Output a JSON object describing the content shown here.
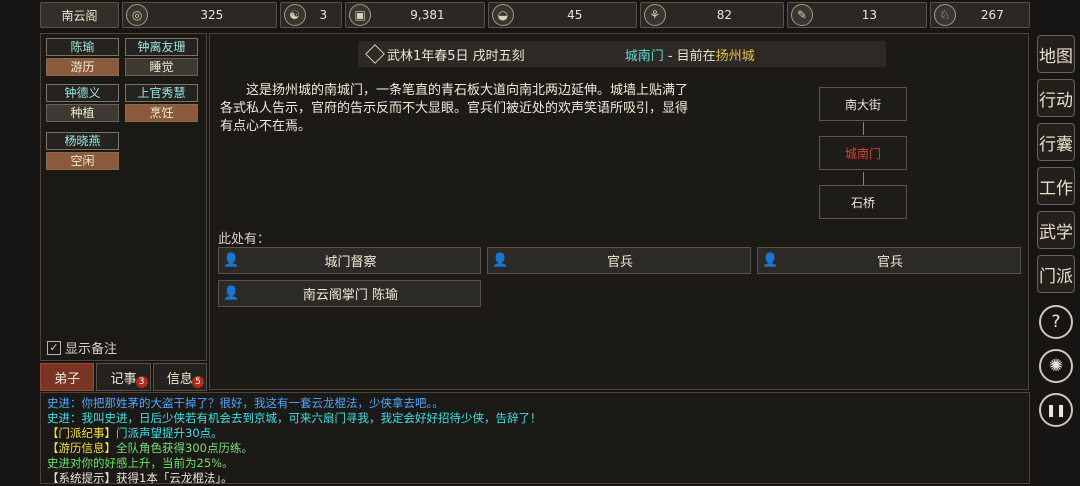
{
  "topbar": {
    "sect_name": "南云阁",
    "stats": [
      {
        "icon": "coin-icon",
        "glyph": "◎",
        "value": "325"
      },
      {
        "icon": "yinyang-icon",
        "glyph": "☯",
        "value": "3"
      },
      {
        "icon": "money-icon",
        "glyph": "▣",
        "value": "9,381"
      },
      {
        "icon": "food-bowl-icon",
        "glyph": "◒",
        "value": "45"
      },
      {
        "icon": "herb-icon",
        "glyph": "⚘",
        "value": "82"
      },
      {
        "icon": "scroll-icon",
        "glyph": "✎",
        "value": "13"
      },
      {
        "icon": "horse-icon",
        "glyph": "♘",
        "value": "267"
      }
    ]
  },
  "disciples": [
    {
      "name": "陈瑜",
      "status": "游历",
      "active": true
    },
    {
      "name": "钟离友珊",
      "status": "睡觉",
      "active": false
    },
    {
      "name": "钟德义",
      "status": "种植",
      "active": false
    },
    {
      "name": "上官秀慧",
      "status": "烹饪",
      "active": true
    },
    {
      "name": "杨晓燕",
      "status": "空闲",
      "active": true
    }
  ],
  "memo_label": "显示备注",
  "bottom_tabs": [
    {
      "label": "弟子",
      "badge": ""
    },
    {
      "label": "记事",
      "badge": "3"
    },
    {
      "label": "信息",
      "badge": "5"
    }
  ],
  "header": {
    "time": "武林1年春5日 戌时五刻",
    "location": "城南门",
    "separator": " - 目前在",
    "city": "扬州城"
  },
  "description": "这是扬州城的南城门，一条笔直的青石板大道向南北两边延伸。城墙上贴满了各式私人告示，官府的告示反而不大显眼。官兵们被近处的欢声笑语所吸引，显得有点心不在焉。",
  "map": {
    "north": "南大街",
    "current": "城南门",
    "south": "石桥"
  },
  "here_label": "此处有：",
  "npcs": [
    "城门督察",
    "官兵",
    "官兵",
    "南云阁掌门 陈瑜"
  ],
  "log": [
    {
      "color": "c-blue",
      "text": "史进：你把那姓茅的大盗干掉了？很好，我这有一套云龙棍法，少侠拿去吧。。"
    },
    {
      "color": "c-cyan",
      "text": "史进：我叫史进，日后少侠若有机会去到京城，可来六扇门寻我，我定会好好招待少侠，告辞了！"
    },
    {
      "color": "c-yellow",
      "prefix": "【门派纪事】",
      "text": "门派声望提升30点。",
      "textcolor": "c-cyan"
    },
    {
      "color": "c-yellow",
      "prefix": "【游历信息】",
      "text": "全队角色获得300点历练。",
      "textcolor": "c-lgreen"
    },
    {
      "color": "c-green",
      "text": "史进对你的好感上升，当前为25%。"
    },
    {
      "color": "c-white",
      "text": "【系统提示】获得1本「云龙棍法」。"
    }
  ],
  "right_menu": [
    "地图",
    "行动",
    "行囊",
    "工作",
    "武学",
    "门派"
  ],
  "right_round": [
    {
      "icon": "help-icon",
      "glyph": "?"
    },
    {
      "icon": "settings-gear-icon",
      "glyph": "✺"
    },
    {
      "icon": "pause-icon",
      "glyph": "❚❚"
    }
  ],
  "colors": {
    "accent": "#7a3424",
    "location": "#60d8d0",
    "city": "#e8c24a",
    "current_map": "#e03a30"
  }
}
